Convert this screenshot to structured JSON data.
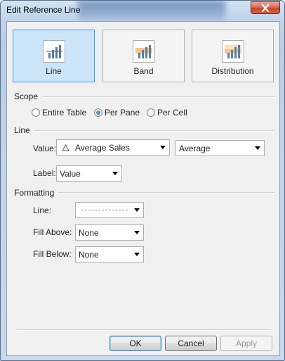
{
  "window": {
    "title": "Edit Reference Line"
  },
  "types": [
    {
      "label": "Line",
      "selected": true,
      "icon": "line-chart-icon"
    },
    {
      "label": "Band",
      "selected": false,
      "icon": "band-chart-icon"
    },
    {
      "label": "Distribution",
      "selected": false,
      "icon": "distribution-chart-icon"
    }
  ],
  "scope": {
    "heading": "Scope",
    "options": [
      "Entire Table",
      "Per Pane",
      "Per Cell"
    ],
    "selected": "Per Pane"
  },
  "line": {
    "heading": "Line",
    "value_label": "Value:",
    "value_field": "Average Sales",
    "aggregation": "Average",
    "label_label": "Label:",
    "label_value": "Value"
  },
  "formatting": {
    "heading": "Formatting",
    "line_label": "Line:",
    "fill_above_label": "Fill Above:",
    "fill_above_value": "None",
    "fill_below_label": "Fill Below:",
    "fill_below_value": "None"
  },
  "buttons": {
    "ok": "OK",
    "cancel": "Cancel",
    "apply": "Apply"
  },
  "colors": {
    "accent_selected": "#cce4f7",
    "accent_border": "#3399ff",
    "chart_bar": "#5b7fa6",
    "band_fill": "#f6c58d"
  }
}
